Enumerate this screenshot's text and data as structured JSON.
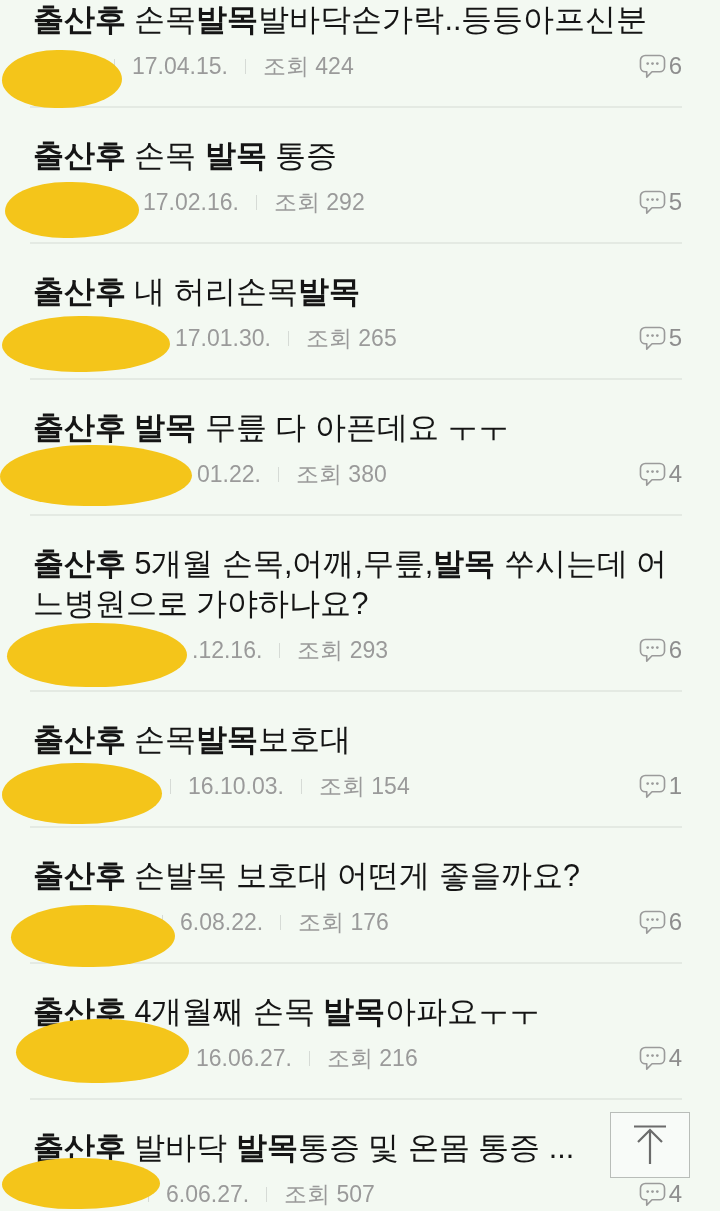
{
  "posts": [
    {
      "title": "**출산후** 손목**발목**발바닥손가락..등등아프신분",
      "author_redacted": true,
      "date": "17.04.15.",
      "views": "조회 424",
      "comments": "6"
    },
    {
      "title": "**출산후** 손목 **발목** 통증",
      "author_redacted": true,
      "date": "17.02.16.",
      "views": "조회 292",
      "comments": "5"
    },
    {
      "title": "**출산후** 내 허리손목**발목**",
      "author_redacted": true,
      "date": "17.01.30.",
      "views": "조회 265",
      "comments": "5"
    },
    {
      "title": "**출산후** **발목** 무릎 다 아픈데요 ㅜㅜ",
      "author_redacted": true,
      "date": "01.22.",
      "views": "조회 380",
      "comments": "4"
    },
    {
      "title": "**출산후** 5개월 손목,어깨,무릎,**발목** 쑤시는데 어느병원으로 가야하나요?",
      "author_redacted": true,
      "date": ".12.16.",
      "views": "조회 293",
      "comments": "6"
    },
    {
      "title": "**출산후** 손목**발목**보호대",
      "author_redacted": true,
      "date": "16.10.03.",
      "views": "조회 154",
      "comments": "1"
    },
    {
      "title": "**출산후** 손발목 보호대 어떤게 좋을까요?",
      "author_redacted": true,
      "date": "6.08.22.",
      "views": "조회 176",
      "comments": "6"
    },
    {
      "title": "**출산후** 4개월째 손목 **발목**아파요ㅜㅜ",
      "author_redacted": true,
      "date": "16.06.27.",
      "views": "조회 216",
      "comments": "4"
    },
    {
      "title": "**출산후** 발바닥 **발목**통증 및 온몸 통증 ...",
      "author_redacted": true,
      "date": "6.06.27.",
      "views": "조회 507",
      "comments": "4"
    }
  ]
}
